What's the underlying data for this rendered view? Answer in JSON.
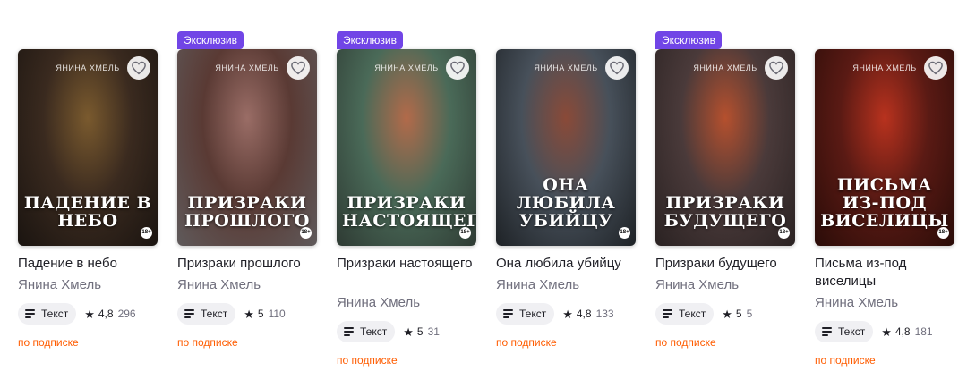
{
  "books": [
    {
      "badge": "",
      "cover_author": "ЯНИНА ХМЕЛЬ",
      "cover_title": "ПАДЕНИЕ В НЕБО",
      "cover_age": "18+",
      "cover_colors": [
        "#3a2a1f",
        "#7a5a2e",
        "#1a1410"
      ],
      "title": "Падение в небо",
      "author": "Янина Хмель",
      "format": "Текст",
      "rating": "4,8",
      "votes": "296",
      "access": "по подписке"
    },
    {
      "badge": "Эксклюзив",
      "cover_author": "ЯНИНА ХМЕЛЬ",
      "cover_title": "ПРИЗРАКИ ПРОШЛОГО",
      "cover_age": "18+",
      "cover_colors": [
        "#5a3a34",
        "#9a6d66",
        "#5f5a5b"
      ],
      "title": "Призраки прошлого",
      "author": "Янина Хмель",
      "format": "Текст",
      "rating": "5",
      "votes": "110",
      "access": "по подписке"
    },
    {
      "badge": "Эксклюзив",
      "cover_author": "ЯНИНА ХМЕЛЬ",
      "cover_title": "ПРИЗРАКИ НАСТОЯЩЕГО",
      "cover_age": "18+",
      "cover_colors": [
        "#4a6a58",
        "#b26a4a",
        "#2e3a33"
      ],
      "title": "Призраки настоящего",
      "author": "Янина Хмель",
      "format": "Текст",
      "rating": "5",
      "votes": "31",
      "access": "по подписке"
    },
    {
      "badge": "",
      "cover_author": "ЯНИНА ХМЕЛЬ",
      "cover_title": "ОНА ЛЮБИЛА УБИЙЦУ",
      "cover_age": "18+",
      "cover_colors": [
        "#47505a",
        "#8a4a38",
        "#1e2226"
      ],
      "title": "Она любила убийцу",
      "author": "Янина Хмель",
      "format": "Текст",
      "rating": "4,8",
      "votes": "133",
      "access": "по подписке"
    },
    {
      "badge": "Эксклюзив",
      "cover_author": "ЯНИНА ХМЕЛЬ",
      "cover_title": "ПРИЗРАКИ БУДУЩЕГО",
      "cover_age": "18+",
      "cover_colors": [
        "#4a3a3a",
        "#b5502e",
        "#2a2222"
      ],
      "title": "Призраки будущего",
      "author": "Янина Хмель",
      "format": "Текст",
      "rating": "5",
      "votes": "5",
      "access": "по подписке"
    },
    {
      "badge": "",
      "cover_author": "ЯНИНА ХМЕЛЬ",
      "cover_title": "ПИСЬМА из-под виселицы",
      "cover_age": "18+",
      "cover_colors": [
        "#5a1a14",
        "#b8321e",
        "#2a0c08"
      ],
      "title": "Письма из-под виселицы",
      "author": "Янина Хмель",
      "format": "Текст",
      "rating": "4,8",
      "votes": "181",
      "access": "по подписке"
    }
  ],
  "colors": {
    "badge": "#7145e6",
    "subscription": "#ff5c00"
  },
  "icons": {
    "favorite": "heart-icon",
    "format": "text-lines-icon",
    "rating": "star-icon"
  }
}
